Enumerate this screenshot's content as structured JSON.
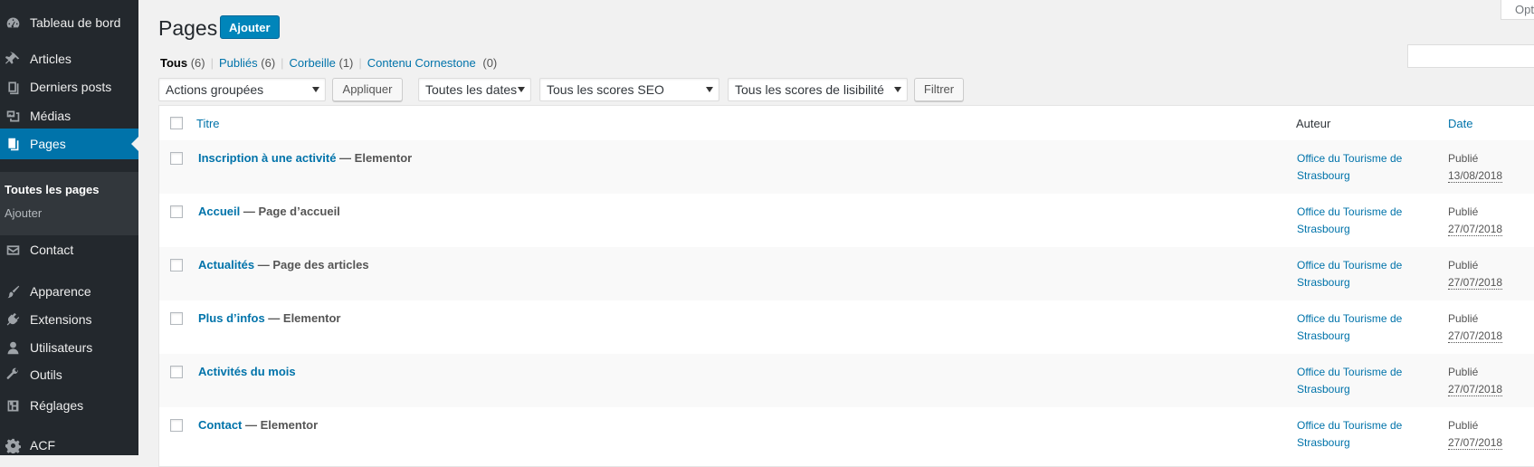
{
  "sidebar": {
    "items": [
      {
        "label": "Tableau de bord",
        "icon": "dashboard-icon"
      },
      {
        "label": "Articles",
        "icon": "pin-icon"
      },
      {
        "label": "Derniers posts",
        "icon": "posts-icon"
      },
      {
        "label": "Médias",
        "icon": "media-icon"
      },
      {
        "label": "Pages",
        "icon": "pages-icon",
        "active": true
      },
      {
        "label": "Contact",
        "icon": "mail-icon"
      },
      {
        "label": "Apparence",
        "icon": "brush-icon"
      },
      {
        "label": "Extensions",
        "icon": "plugin-icon"
      },
      {
        "label": "Utilisateurs",
        "icon": "user-icon"
      },
      {
        "label": "Outils",
        "icon": "wrench-icon"
      },
      {
        "label": "Réglages",
        "icon": "settings-icon"
      },
      {
        "label": "ACF",
        "icon": "gear-icon"
      }
    ],
    "submenu": [
      {
        "label": "Toutes les pages",
        "current": true
      },
      {
        "label": "Ajouter"
      }
    ]
  },
  "header": {
    "title": "Pages",
    "add_button": "Ajouter",
    "screen_options": "Opt"
  },
  "views": {
    "all": {
      "label": "Tous",
      "count": "(6)"
    },
    "published": {
      "label": "Publiés",
      "count": "(6)"
    },
    "trash": {
      "label": "Corbeille",
      "count": "(1)"
    },
    "cornerstone": {
      "label": "Contenu Cornestone",
      "count": "(0)"
    }
  },
  "filters": {
    "bulk_actions": "Actions groupées",
    "apply": "Appliquer",
    "dates": "Toutes les dates",
    "seo_scores": "Tous les scores SEO",
    "readability": "Tous les scores de lisibilité",
    "filter": "Filtrer"
  },
  "table": {
    "columns": {
      "title": "Titre",
      "author": "Auteur",
      "date": "Date"
    },
    "rows": [
      {
        "title": "Inscription à une activité",
        "state": " — Elementor",
        "author_line1": "Office du Tourisme de",
        "author_line2": "Strasbourg",
        "status": "Publié",
        "date": "13/08/2018"
      },
      {
        "title": "Accueil",
        "state": " — Page d’accueil",
        "author_line1": "Office du Tourisme de",
        "author_line2": "Strasbourg",
        "status": "Publié",
        "date": "27/07/2018"
      },
      {
        "title": "Actualités",
        "state": " — Page des articles",
        "author_line1": "Office du Tourisme de",
        "author_line2": "Strasbourg",
        "status": "Publié",
        "date": "27/07/2018"
      },
      {
        "title": "Plus d’infos",
        "state": " — Elementor",
        "author_line1": "Office du Tourisme de",
        "author_line2": "Strasbourg",
        "status": "Publié",
        "date": "27/07/2018"
      },
      {
        "title": "Activités du mois",
        "state": "",
        "author_line1": "Office du Tourisme de",
        "author_line2": "Strasbourg",
        "status": "Publié",
        "date": "27/07/2018"
      },
      {
        "title": "Contact",
        "state": " — Elementor",
        "author_line1": "Office du Tourisme de",
        "author_line2": "Strasbourg",
        "status": "Publié",
        "date": "27/07/2018"
      }
    ]
  },
  "colors": {
    "sidebar_bg": "#23282d",
    "active_blue": "#0073aa",
    "primary_button": "#0085ba"
  }
}
